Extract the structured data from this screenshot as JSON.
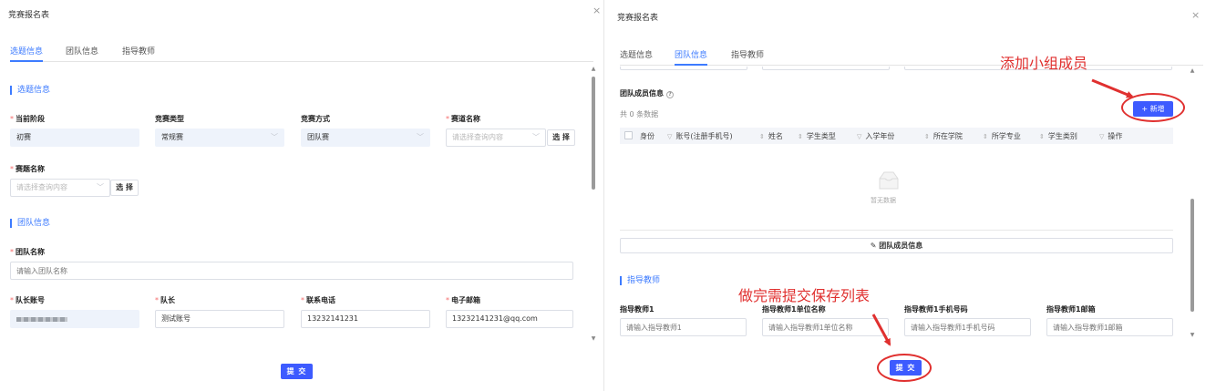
{
  "left": {
    "title": "竞赛报名表",
    "close": "×",
    "tabs": [
      "选题信息",
      "团队信息",
      "指导教师"
    ],
    "section_topic": "选题信息",
    "fields": {
      "stage_label": "当前阶段",
      "stage_value": "初赛",
      "type_label": "竞赛类型",
      "type_value": "常规赛",
      "mode_label": "竞赛方式",
      "mode_value": "团队赛",
      "track_label": "赛道名称",
      "track_placeholder": "请选择查询内容",
      "problem_label": "赛题名称",
      "problem_placeholder": "请选择查询内容",
      "pick": "选 择"
    },
    "section_team": "团队信息",
    "team": {
      "name_label": "团队名称",
      "name_placeholder": "请输入团队名称",
      "captain_account_label": "队长账号",
      "captain_label": "队长",
      "captain_value": "测试账号",
      "phone_label": "联系电话",
      "phone_value": "13232141231",
      "email_label": "电子邮箱",
      "email_value": "13232141231@qq.com"
    },
    "submit": "提 交"
  },
  "right": {
    "title": "竞赛报名表",
    "close": "×",
    "tabs": [
      "选题信息",
      "团队信息",
      "指导教师"
    ],
    "members_title": "团队成员信息",
    "members_count": "共 0 条数据",
    "add_button": "+ 新增",
    "columns": [
      "身份",
      "账号(注册手机号)",
      "姓名",
      "学生类型",
      "入学年份",
      "所在学院",
      "所学专业",
      "学生类别",
      "操作"
    ],
    "empty_text": "暂无数据",
    "add_member_row": "团队成员信息",
    "section_teacher": "指导教师",
    "teacher_fields": [
      {
        "label": "指导教师1",
        "placeholder": "请输入指导教师1"
      },
      {
        "label": "指导教师1单位名称",
        "placeholder": "请输入指导教师1单位名称"
      },
      {
        "label": "指导教师1手机号码",
        "placeholder": "请输入指导教师1手机号码"
      },
      {
        "label": "指导教师1邮箱",
        "placeholder": "请输入指导教师1邮箱"
      }
    ],
    "submit": "提 交",
    "annotation_add": "添加小组成员",
    "annotation_submit": "做完需提交保存列表"
  },
  "colors": {
    "accent": "#3d7bff",
    "button": "#3d5bff",
    "required": "#f56c6c",
    "annotation": "#e0302f"
  }
}
